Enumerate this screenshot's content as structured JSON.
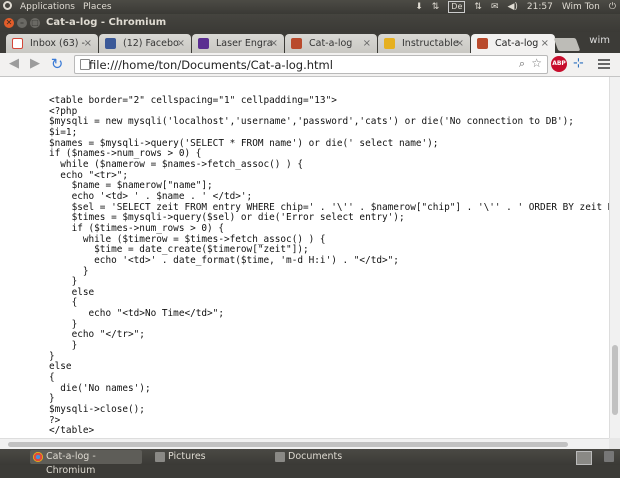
{
  "top_panel": {
    "menus": [
      "Applications",
      "Places"
    ],
    "keyboard_layout": "De",
    "clock": "21:57",
    "user": "Wim Ton"
  },
  "window": {
    "title": "Cat-a-log - Chromium"
  },
  "tabs": [
    {
      "label": "Inbox (63) -",
      "favicon": "gmail-icon",
      "color": "#d44638"
    },
    {
      "label": "(12) Facebo",
      "favicon": "facebook-icon",
      "color": "#3b5998"
    },
    {
      "label": "Laser Engra",
      "favicon": "yahoo-icon",
      "color": "#5b2e91"
    },
    {
      "label": "Cat-a-log",
      "favicon": "page-icon",
      "color": "#b94a2c"
    },
    {
      "label": "Instructable",
      "favicon": "robot-icon",
      "color": "#e6b020"
    },
    {
      "label": "Cat-a-log",
      "favicon": "page-icon",
      "color": "#b94a2c",
      "active": true
    }
  ],
  "tabstrip_user": "wim",
  "toolbar": {
    "url": "file:///home/ton/Documents/Cat-a-log.html",
    "abp_label": "ABP"
  },
  "code_lines": [
    "<table border=\"2\" cellspacing=\"1\" cellpadding=\"13\">",
    "<?php",
    "$mysqli = new mysqli('localhost','username','password','cats') or die('No connection to DB');",
    "$i=1;",
    "$names = $mysqli->query('SELECT * FROM name') or die(' select name');",
    "if ($names->num_rows > 0) {",
    "  while ($namerow = $names->fetch_assoc() ) {",
    "  echo \"<tr>\";",
    "    $name = $namerow[\"name\"];",
    "    echo '<td> ' . $name . ' </td>';",
    "    $sel = 'SELECT zeit FROM entry WHERE chip=' . '\\'' . $namerow[\"chip\"] . '\\'' . ' ORDER BY zeit DESC L",
    "    $times = $mysqli->query($sel) or die('Error select entry');",
    "    if ($times->num_rows > 0) {",
    "      while ($timerow = $times->fetch_assoc() ) {",
    "        $time = date_create($timerow[\"zeit\"]);",
    "        echo '<td>' . date_format($time, 'm-d H:i') . \"</td>\";",
    "      }",
    "    }",
    "    else",
    "    {",
    "       echo \"<td>No Time</td>\";",
    "    }",
    "    echo \"</tr>\";",
    "    }",
    "}",
    "else",
    "{",
    "  die('No names');",
    "}",
    "$mysqli->close();",
    "?>",
    "</table>"
  ],
  "taskbar": [
    {
      "label": "Cat-a-log - Chromium",
      "icon": "chromium-icon",
      "active": true
    },
    {
      "label": "Pictures",
      "icon": "folder-icon"
    },
    {
      "label": "Documents",
      "icon": "folder-icon"
    }
  ]
}
